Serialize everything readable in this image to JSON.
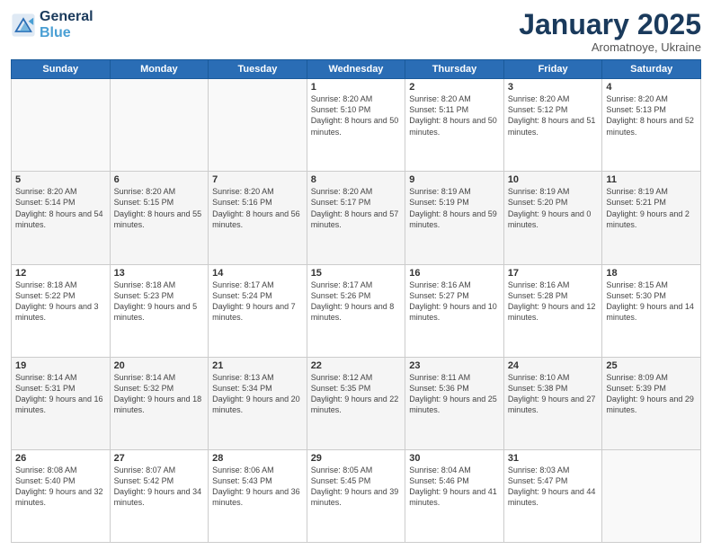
{
  "header": {
    "logo_line1": "General",
    "logo_line2": "Blue",
    "month": "January 2025",
    "location": "Aromatnoye, Ukraine"
  },
  "weekdays": [
    "Sunday",
    "Monday",
    "Tuesday",
    "Wednesday",
    "Thursday",
    "Friday",
    "Saturday"
  ],
  "weeks": [
    [
      {
        "day": "",
        "sunrise": "",
        "sunset": "",
        "daylight": ""
      },
      {
        "day": "",
        "sunrise": "",
        "sunset": "",
        "daylight": ""
      },
      {
        "day": "",
        "sunrise": "",
        "sunset": "",
        "daylight": ""
      },
      {
        "day": "1",
        "sunrise": "Sunrise: 8:20 AM",
        "sunset": "Sunset: 5:10 PM",
        "daylight": "Daylight: 8 hours and 50 minutes."
      },
      {
        "day": "2",
        "sunrise": "Sunrise: 8:20 AM",
        "sunset": "Sunset: 5:11 PM",
        "daylight": "Daylight: 8 hours and 50 minutes."
      },
      {
        "day": "3",
        "sunrise": "Sunrise: 8:20 AM",
        "sunset": "Sunset: 5:12 PM",
        "daylight": "Daylight: 8 hours and 51 minutes."
      },
      {
        "day": "4",
        "sunrise": "Sunrise: 8:20 AM",
        "sunset": "Sunset: 5:13 PM",
        "daylight": "Daylight: 8 hours and 52 minutes."
      }
    ],
    [
      {
        "day": "5",
        "sunrise": "Sunrise: 8:20 AM",
        "sunset": "Sunset: 5:14 PM",
        "daylight": "Daylight: 8 hours and 54 minutes."
      },
      {
        "day": "6",
        "sunrise": "Sunrise: 8:20 AM",
        "sunset": "Sunset: 5:15 PM",
        "daylight": "Daylight: 8 hours and 55 minutes."
      },
      {
        "day": "7",
        "sunrise": "Sunrise: 8:20 AM",
        "sunset": "Sunset: 5:16 PM",
        "daylight": "Daylight: 8 hours and 56 minutes."
      },
      {
        "day": "8",
        "sunrise": "Sunrise: 8:20 AM",
        "sunset": "Sunset: 5:17 PM",
        "daylight": "Daylight: 8 hours and 57 minutes."
      },
      {
        "day": "9",
        "sunrise": "Sunrise: 8:19 AM",
        "sunset": "Sunset: 5:19 PM",
        "daylight": "Daylight: 8 hours and 59 minutes."
      },
      {
        "day": "10",
        "sunrise": "Sunrise: 8:19 AM",
        "sunset": "Sunset: 5:20 PM",
        "daylight": "Daylight: 9 hours and 0 minutes."
      },
      {
        "day": "11",
        "sunrise": "Sunrise: 8:19 AM",
        "sunset": "Sunset: 5:21 PM",
        "daylight": "Daylight: 9 hours and 2 minutes."
      }
    ],
    [
      {
        "day": "12",
        "sunrise": "Sunrise: 8:18 AM",
        "sunset": "Sunset: 5:22 PM",
        "daylight": "Daylight: 9 hours and 3 minutes."
      },
      {
        "day": "13",
        "sunrise": "Sunrise: 8:18 AM",
        "sunset": "Sunset: 5:23 PM",
        "daylight": "Daylight: 9 hours and 5 minutes."
      },
      {
        "day": "14",
        "sunrise": "Sunrise: 8:17 AM",
        "sunset": "Sunset: 5:24 PM",
        "daylight": "Daylight: 9 hours and 7 minutes."
      },
      {
        "day": "15",
        "sunrise": "Sunrise: 8:17 AM",
        "sunset": "Sunset: 5:26 PM",
        "daylight": "Daylight: 9 hours and 8 minutes."
      },
      {
        "day": "16",
        "sunrise": "Sunrise: 8:16 AM",
        "sunset": "Sunset: 5:27 PM",
        "daylight": "Daylight: 9 hours and 10 minutes."
      },
      {
        "day": "17",
        "sunrise": "Sunrise: 8:16 AM",
        "sunset": "Sunset: 5:28 PM",
        "daylight": "Daylight: 9 hours and 12 minutes."
      },
      {
        "day": "18",
        "sunrise": "Sunrise: 8:15 AM",
        "sunset": "Sunset: 5:30 PM",
        "daylight": "Daylight: 9 hours and 14 minutes."
      }
    ],
    [
      {
        "day": "19",
        "sunrise": "Sunrise: 8:14 AM",
        "sunset": "Sunset: 5:31 PM",
        "daylight": "Daylight: 9 hours and 16 minutes."
      },
      {
        "day": "20",
        "sunrise": "Sunrise: 8:14 AM",
        "sunset": "Sunset: 5:32 PM",
        "daylight": "Daylight: 9 hours and 18 minutes."
      },
      {
        "day": "21",
        "sunrise": "Sunrise: 8:13 AM",
        "sunset": "Sunset: 5:34 PM",
        "daylight": "Daylight: 9 hours and 20 minutes."
      },
      {
        "day": "22",
        "sunrise": "Sunrise: 8:12 AM",
        "sunset": "Sunset: 5:35 PM",
        "daylight": "Daylight: 9 hours and 22 minutes."
      },
      {
        "day": "23",
        "sunrise": "Sunrise: 8:11 AM",
        "sunset": "Sunset: 5:36 PM",
        "daylight": "Daylight: 9 hours and 25 minutes."
      },
      {
        "day": "24",
        "sunrise": "Sunrise: 8:10 AM",
        "sunset": "Sunset: 5:38 PM",
        "daylight": "Daylight: 9 hours and 27 minutes."
      },
      {
        "day": "25",
        "sunrise": "Sunrise: 8:09 AM",
        "sunset": "Sunset: 5:39 PM",
        "daylight": "Daylight: 9 hours and 29 minutes."
      }
    ],
    [
      {
        "day": "26",
        "sunrise": "Sunrise: 8:08 AM",
        "sunset": "Sunset: 5:40 PM",
        "daylight": "Daylight: 9 hours and 32 minutes."
      },
      {
        "day": "27",
        "sunrise": "Sunrise: 8:07 AM",
        "sunset": "Sunset: 5:42 PM",
        "daylight": "Daylight: 9 hours and 34 minutes."
      },
      {
        "day": "28",
        "sunrise": "Sunrise: 8:06 AM",
        "sunset": "Sunset: 5:43 PM",
        "daylight": "Daylight: 9 hours and 36 minutes."
      },
      {
        "day": "29",
        "sunrise": "Sunrise: 8:05 AM",
        "sunset": "Sunset: 5:45 PM",
        "daylight": "Daylight: 9 hours and 39 minutes."
      },
      {
        "day": "30",
        "sunrise": "Sunrise: 8:04 AM",
        "sunset": "Sunset: 5:46 PM",
        "daylight": "Daylight: 9 hours and 41 minutes."
      },
      {
        "day": "31",
        "sunrise": "Sunrise: 8:03 AM",
        "sunset": "Sunset: 5:47 PM",
        "daylight": "Daylight: 9 hours and 44 minutes."
      },
      {
        "day": "",
        "sunrise": "",
        "sunset": "",
        "daylight": ""
      }
    ]
  ]
}
